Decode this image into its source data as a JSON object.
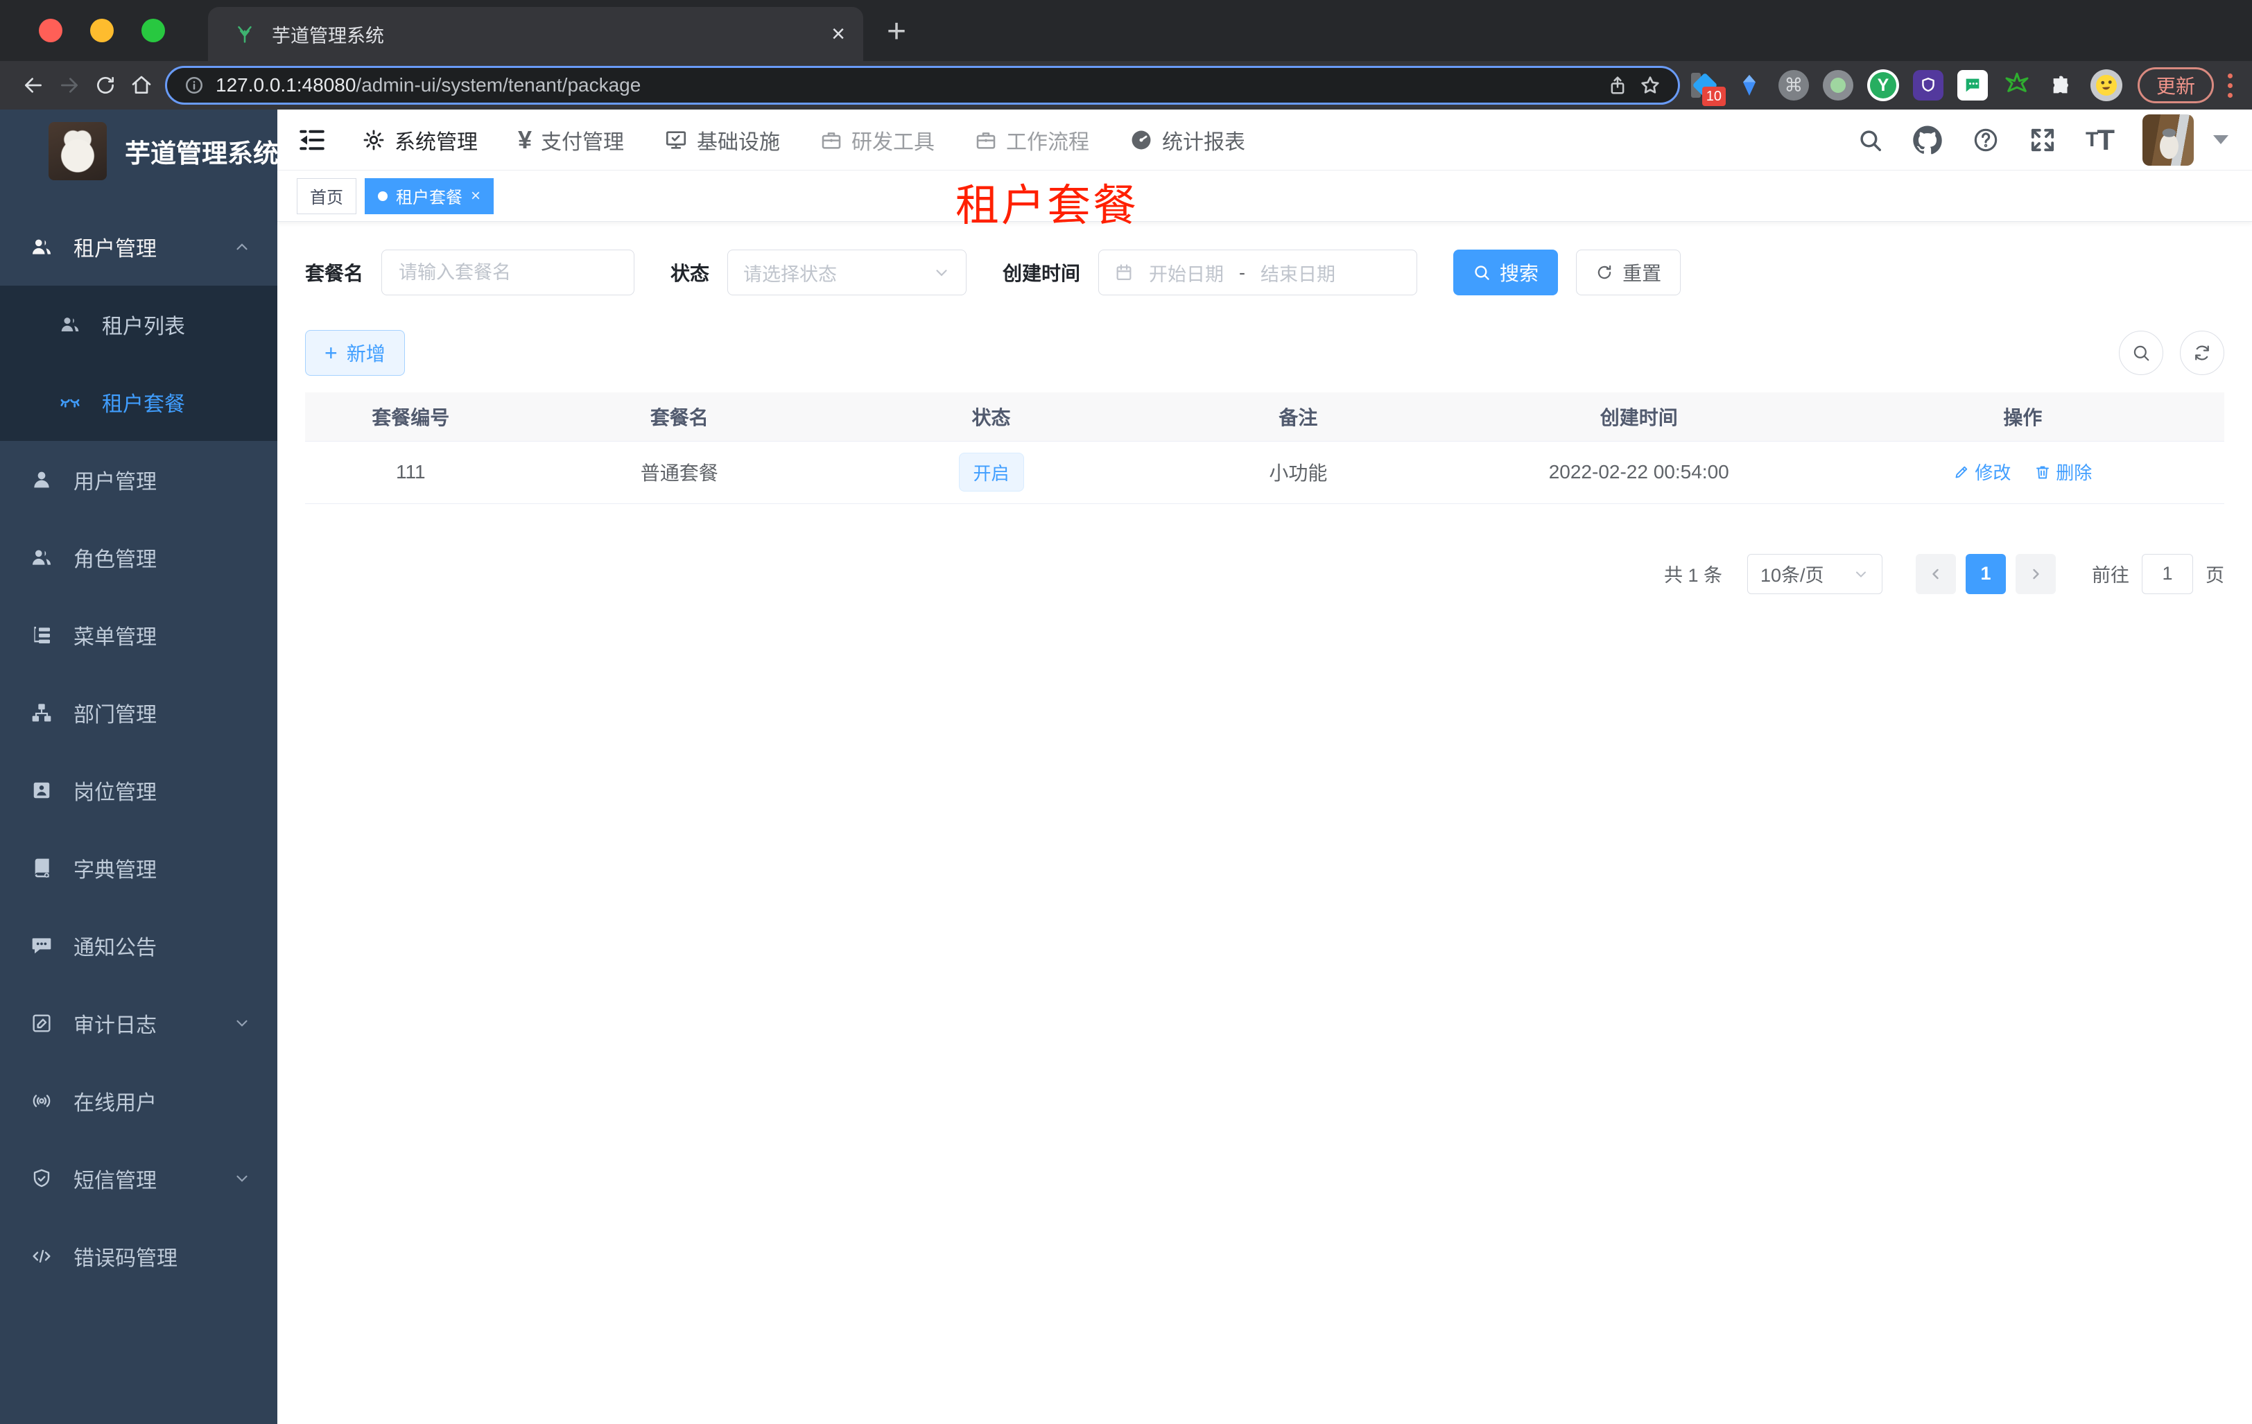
{
  "browser": {
    "tab_title": "芋道管理系统",
    "url_host": "127.0.0.1:48080",
    "url_path": "/admin-ui/system/tenant/package",
    "ext_badge": "10",
    "update_label": "更新"
  },
  "sidebar": {
    "brand": "芋道管理系统",
    "menu": [
      {
        "label": "租户管理"
      },
      {
        "label": "租户列表"
      },
      {
        "label": "租户套餐"
      },
      {
        "label": "用户管理"
      },
      {
        "label": "角色管理"
      },
      {
        "label": "菜单管理"
      },
      {
        "label": "部门管理"
      },
      {
        "label": "岗位管理"
      },
      {
        "label": "字典管理"
      },
      {
        "label": "通知公告"
      },
      {
        "label": "审计日志"
      },
      {
        "label": "在线用户"
      },
      {
        "label": "短信管理"
      },
      {
        "label": "错误码管理"
      }
    ]
  },
  "header": {
    "nav": [
      {
        "label": "系统管理"
      },
      {
        "label": "支付管理"
      },
      {
        "label": "基础设施"
      },
      {
        "label": "研发工具"
      },
      {
        "label": "工作流程"
      },
      {
        "label": "统计报表"
      }
    ]
  },
  "tags": {
    "items": [
      {
        "label": "首页"
      },
      {
        "label": "租户套餐"
      }
    ]
  },
  "annotation": {
    "text": "租户套餐",
    "color": "#ff2000"
  },
  "filters": {
    "name_label": "套餐名",
    "name_placeholder": "请输入套餐名",
    "status_label": "状态",
    "status_placeholder": "请选择状态",
    "time_label": "创建时间",
    "start_placeholder": "开始日期",
    "separator": "-",
    "end_placeholder": "结束日期",
    "search_label": "搜索",
    "reset_label": "重置"
  },
  "toolbar": {
    "add_label": "新增"
  },
  "table": {
    "columns": [
      "套餐编号",
      "套餐名",
      "状态",
      "备注",
      "创建时间",
      "操作"
    ],
    "rows": [
      {
        "id": "111",
        "name": "普通套餐",
        "status": "开启",
        "remark": "小功能",
        "created": "2022-02-22 00:54:00",
        "edit": "修改",
        "delete": "删除"
      }
    ]
  },
  "pagination": {
    "total": "共 1 条",
    "page_size": "10条/页",
    "current": "1",
    "go_prefix": "前往",
    "jump_value": "1",
    "go_suffix": "页"
  },
  "colors": {
    "accent": "#409eff",
    "sidebar_bg": "#304156",
    "submenu_bg": "#1f2d3d",
    "annotation_red": "#ff2000"
  }
}
